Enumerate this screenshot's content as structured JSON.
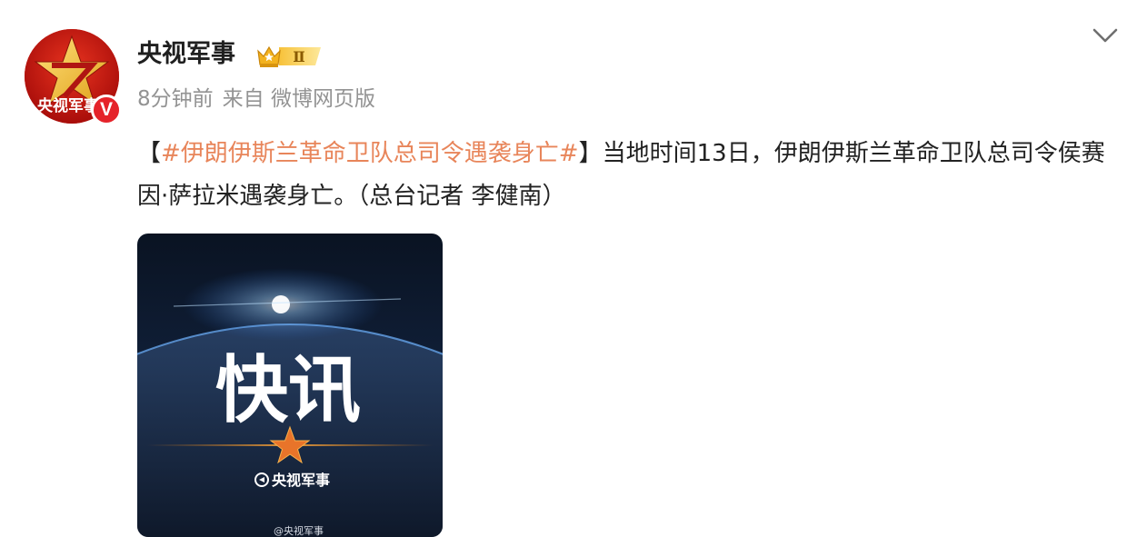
{
  "post": {
    "author": {
      "name": "央视军事",
      "avatar_text": "央视军事",
      "verified_badge": "V",
      "level_badge": "Ⅱ",
      "level_badge_icon": "crown-icon"
    },
    "meta": {
      "time": "8分钟前",
      "source": "来自 微博网页版"
    },
    "content": {
      "bracket_open": "【",
      "hashtag": "#伊朗伊斯兰革命卫队总司令遇袭身亡#",
      "bracket_close": "】",
      "text": "当地时间13日，伊朗伊斯兰革命卫队总司令侯赛因·萨拉米遇袭身亡。（总台记者 李健南）"
    },
    "image": {
      "headline": "快讯",
      "brand": "央视军事",
      "watermark": "@央视军事"
    },
    "colors": {
      "hashtag": "#e8855a",
      "name": "#1f1f1f",
      "meta": "#939393",
      "accent_red": "#e5232a"
    },
    "menu_icon": "chevron-down-icon"
  }
}
